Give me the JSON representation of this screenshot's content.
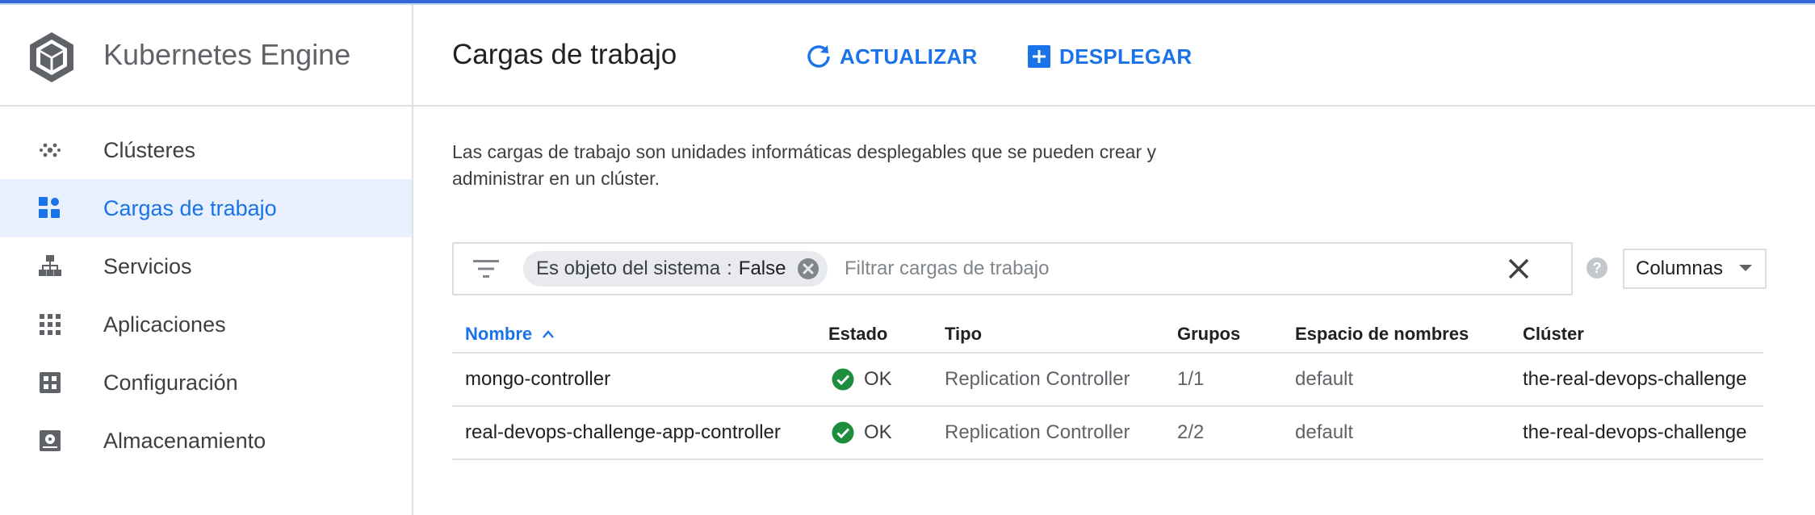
{
  "app": {
    "name": "Kubernetes Engine",
    "accent": "#1a73e8"
  },
  "sidebar": {
    "items": [
      {
        "label": "Clústeres",
        "icon": "clusters-icon",
        "active": false
      },
      {
        "label": "Cargas de trabajo",
        "icon": "workloads-icon",
        "active": true
      },
      {
        "label": "Servicios",
        "icon": "services-icon",
        "active": false
      },
      {
        "label": "Aplicaciones",
        "icon": "applications-icon",
        "active": false
      },
      {
        "label": "Configuración",
        "icon": "configuration-icon",
        "active": false
      },
      {
        "label": "Almacenamiento",
        "icon": "storage-icon",
        "active": false
      }
    ]
  },
  "header": {
    "title": "Cargas de trabajo",
    "refresh_label": "ACTUALIZAR",
    "deploy_label": "DESPLEGAR"
  },
  "main": {
    "description": "Las cargas de trabajo son unidades informáticas desplegables que se pueden crear y administrar en un clúster.",
    "filter": {
      "chip_key": "Es objeto del sistema",
      "chip_sep": ":",
      "chip_value": "False",
      "placeholder": "Filtrar cargas de trabajo",
      "value": ""
    },
    "columns_label": "Columnas"
  },
  "table": {
    "columns": [
      "Nombre",
      "Estado",
      "Tipo",
      "Grupos",
      "Espacio de nombres",
      "Clúster"
    ],
    "sorted_column": "Nombre",
    "sort_direction": "ascending",
    "rows": [
      {
        "name": "mongo-controller",
        "status": "OK",
        "status_color": "#1e8e3e",
        "type": "Replication Controller",
        "pods": "1/1",
        "namespace": "default",
        "cluster": "the-real-devops-challenge"
      },
      {
        "name": "real-devops-challenge-app-controller",
        "status": "OK",
        "status_color": "#1e8e3e",
        "type": "Replication Controller",
        "pods": "2/2",
        "namespace": "default",
        "cluster": "the-real-devops-challenge"
      }
    ]
  }
}
